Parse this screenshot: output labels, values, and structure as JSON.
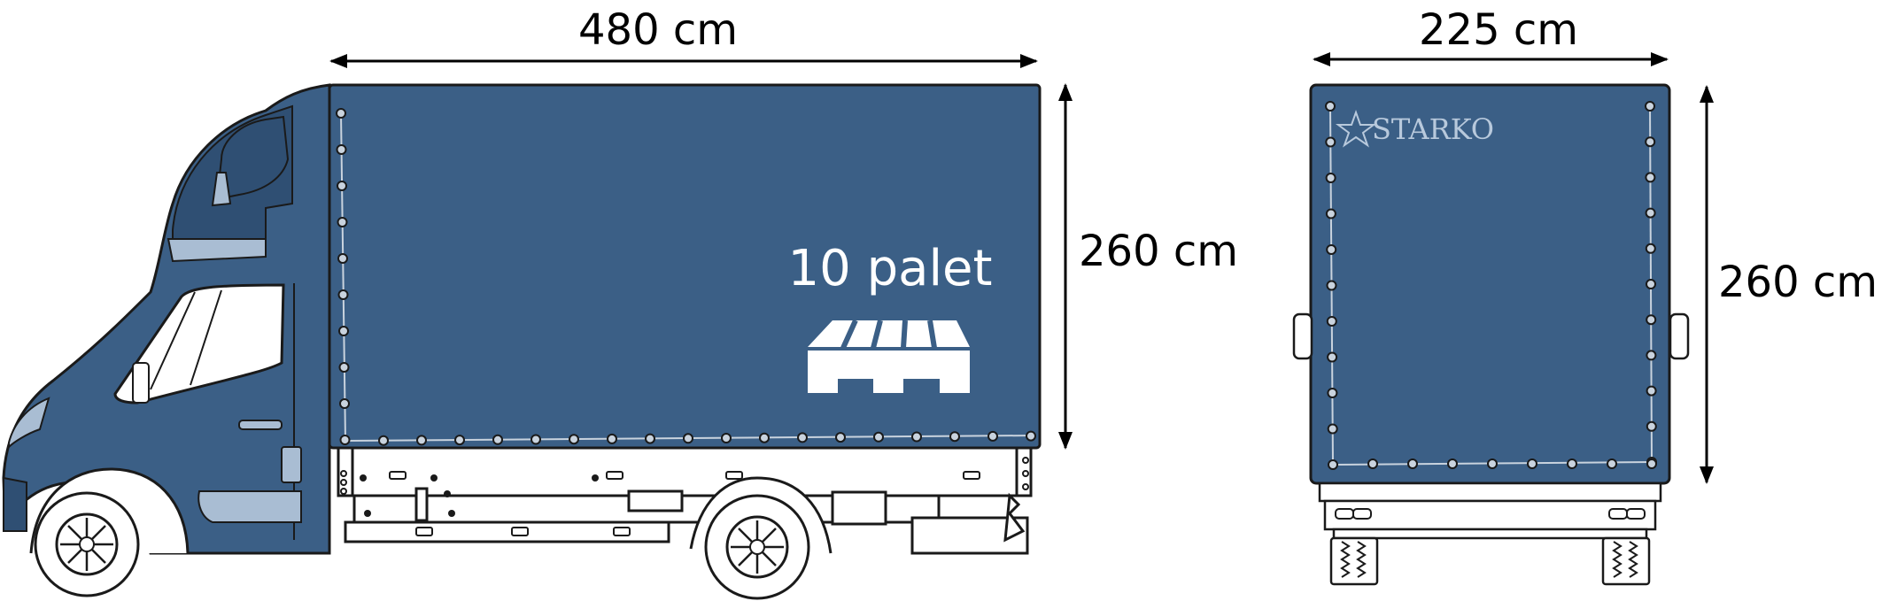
{
  "side_view": {
    "length_label": "480 cm",
    "height_label": "260 cm",
    "capacity_label": "10 palet",
    "icon": "pallet-icon"
  },
  "rear_view": {
    "width_label": "225 cm",
    "height_label": "260 cm",
    "logo_text": "STARKO",
    "logo_icon": "star-icon"
  },
  "colors": {
    "body": "#3b5f86",
    "cab_dark": "#2f4f73",
    "outline": "#1a1a1a",
    "glass": "#ffffff",
    "trim_light": "#a9bdd3",
    "logo": "#b8c9dc"
  }
}
